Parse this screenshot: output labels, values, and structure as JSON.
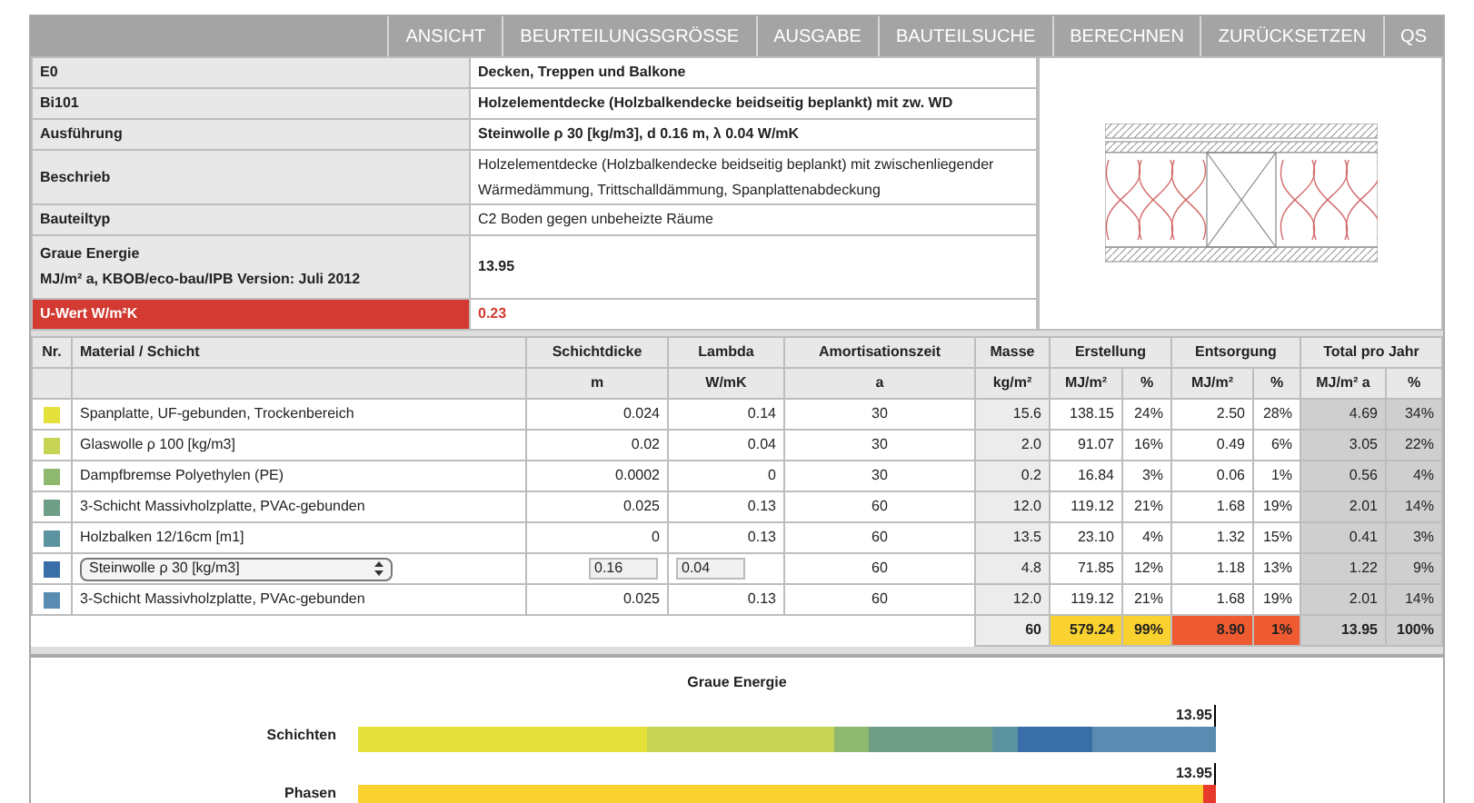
{
  "nav": [
    "ANSICHT",
    "BEURTEILUNGSGRÖSSE",
    "AUSGABE",
    "BAUTEILSUCHE",
    "BERECHNEN",
    "ZURÜCKSETZEN",
    "QS"
  ],
  "info": [
    {
      "label": "E0",
      "value": "Decken, Treppen und Balkone",
      "kind": "bold"
    },
    {
      "label": "Bi101",
      "value": "Holzelementdecke (Holzbalkendecke beidseitig beplankt) mit zw. WD",
      "kind": "bold"
    },
    {
      "label": "Ausführung",
      "value": "Steinwolle ρ 30 [kg/m3], d 0.16 m, λ 0.04 W/mK",
      "kind": "bold"
    },
    {
      "label": "Beschrieb",
      "value": "Holzelementdecke (Holzbalkendecke beidseitig beplankt) mit zwischenliegender Wärmedämmung, Trittschalldämmung, Spanplattenabdeckung",
      "kind": "plain"
    },
    {
      "label": "Bauteiltyp",
      "value": "C2 Boden gegen unbeheizte Räume",
      "kind": "plain"
    },
    {
      "label": "Graue Energie",
      "sublabel": "MJ/m² a, KBOB/eco-bau/IPB Version: Juli 2012",
      "value": "13.95",
      "kind": "bold"
    },
    {
      "label": "U-Wert W/m²K",
      "value": "0.23",
      "kind": "alert"
    }
  ],
  "table": {
    "columns": [
      "Nr.",
      "Material / Schicht",
      "Schichtdicke",
      "Lambda",
      "Amortisationszeit",
      "Masse",
      "Erstellung",
      "Entsorgung",
      "Total pro Jahr"
    ],
    "units": [
      "m",
      "W/mK",
      "a",
      "kg/m²",
      "MJ/m²",
      "%",
      "MJ/m²",
      "%",
      "MJ/m² a",
      "%"
    ],
    "rows": [
      {
        "color": "#e6e03a",
        "kind": "text",
        "material": "Spanplatte, UF-gebunden, Trockenbereich",
        "d": "0.024",
        "lambda": "0.14",
        "a": "30",
        "masse": "15.6",
        "erst": "138.15",
        "erst_pct": "24%",
        "ents": "2.50",
        "ents_pct": "28%",
        "total": "4.69",
        "total_pct": "34%"
      },
      {
        "color": "#c6d456",
        "kind": "text",
        "material": "Glaswolle ρ 100 [kg/m3]",
        "d": "0.02",
        "lambda": "0.04",
        "a": "30",
        "masse": "2.0",
        "erst": "91.07",
        "erst_pct": "16%",
        "ents": "0.49",
        "ents_pct": "6%",
        "total": "3.05",
        "total_pct": "22%"
      },
      {
        "color": "#8db86e",
        "kind": "text",
        "material": "Dampfbremse Polyethylen (PE)",
        "d": "0.0002",
        "lambda": "0",
        "a": "30",
        "masse": "0.2",
        "erst": "16.84",
        "erst_pct": "3%",
        "ents": "0.06",
        "ents_pct": "1%",
        "total": "0.56",
        "total_pct": "4%"
      },
      {
        "color": "#6f9e86",
        "kind": "text",
        "material": "3-Schicht Massivholzplatte, PVAc-gebunden",
        "d": "0.025",
        "lambda": "0.13",
        "a": "60",
        "masse": "12.0",
        "erst": "119.12",
        "erst_pct": "21%",
        "ents": "1.68",
        "ents_pct": "19%",
        "total": "2.01",
        "total_pct": "14%"
      },
      {
        "color": "#5b94a0",
        "kind": "text",
        "material": "Holzbalken 12/16cm [m1]",
        "d": "0",
        "lambda": "0.13",
        "a": "60",
        "masse": "13.5",
        "erst": "23.10",
        "erst_pct": "4%",
        "ents": "1.32",
        "ents_pct": "15%",
        "total": "0.41",
        "total_pct": "3%"
      },
      {
        "color": "#3a6ea8",
        "kind": "select",
        "material": "Steinwolle ρ 30 [kg/m3]",
        "d": "0.16",
        "lambda": "0.04",
        "a": "60",
        "masse": "4.8",
        "erst": "71.85",
        "erst_pct": "12%",
        "ents": "1.18",
        "ents_pct": "13%",
        "total": "1.22",
        "total_pct": "9%"
      },
      {
        "color": "#5a8bb0",
        "kind": "text",
        "material": "3-Schicht Massivholzplatte, PVAc-gebunden",
        "d": "0.025",
        "lambda": "0.13",
        "a": "60",
        "masse": "12.0",
        "erst": "119.12",
        "erst_pct": "21%",
        "ents": "1.68",
        "ents_pct": "19%",
        "total": "2.01",
        "total_pct": "14%"
      }
    ],
    "footer": {
      "masse": "60",
      "erst": "579.24",
      "erst_pct": "99%",
      "ents": "8.90",
      "ents_pct": "1%",
      "total": "13.95",
      "total_pct": "100%"
    }
  },
  "chart": {
    "title": "Graue Energie",
    "bars": [
      {
        "label": "Schichten",
        "total": "13.95",
        "kind": "layers"
      },
      {
        "label": "Phasen",
        "total": "13.95",
        "kind": "phases"
      }
    ]
  }
}
